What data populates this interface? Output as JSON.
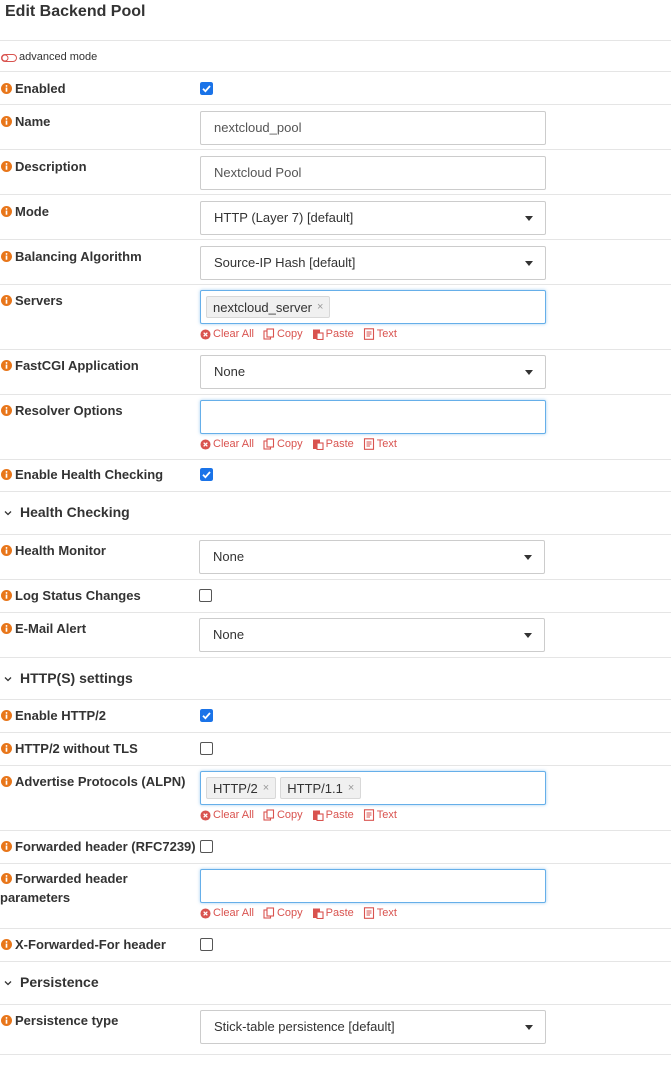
{
  "header": {
    "title": "Edit Backend Pool"
  },
  "advanced_mode": {
    "label": "advanced mode"
  },
  "tools": {
    "clear": "Clear All",
    "copy": "Copy",
    "paste": "Paste",
    "text": "Text"
  },
  "fields": {
    "enabled": {
      "label": "Enabled",
      "checked": true
    },
    "name": {
      "label": "Name",
      "value": "nextcloud_pool"
    },
    "description": {
      "label": "Description",
      "value": "Nextcloud Pool"
    },
    "mode": {
      "label": "Mode",
      "value": "HTTP (Layer 7) [default]"
    },
    "balancing": {
      "label": "Balancing Algorithm",
      "value": "Source-IP Hash [default]"
    },
    "servers": {
      "label": "Servers",
      "tags": [
        "nextcloud_server"
      ]
    },
    "fastcgi": {
      "label": "FastCGI Application",
      "value": "None"
    },
    "resolver": {
      "label": "Resolver Options",
      "value": ""
    },
    "enable_health": {
      "label": "Enable Health Checking",
      "checked": true
    },
    "health_monitor": {
      "label": "Health Monitor",
      "value": "None"
    },
    "log_status": {
      "label": "Log Status Changes",
      "checked": false
    },
    "email_alert": {
      "label": "E-Mail Alert",
      "value": "None"
    },
    "enable_http2": {
      "label": "Enable HTTP/2",
      "checked": true
    },
    "http2_no_tls": {
      "label": "HTTP/2 without TLS",
      "checked": false
    },
    "alpn": {
      "label": "Advertise Protocols (ALPN)",
      "tags": [
        "HTTP/2",
        "HTTP/1.1"
      ]
    },
    "fwd_header": {
      "label": "Forwarded header (RFC7239)",
      "checked": false
    },
    "fwd_params": {
      "label": "Forwarded header parameters",
      "value": ""
    },
    "xff": {
      "label": "X-Forwarded-For header",
      "checked": false
    },
    "persistence_type": {
      "label": "Persistence type",
      "value": "Stick-table persistence [default]"
    }
  },
  "sections": {
    "health": "Health Checking",
    "http": "HTTP(S) settings",
    "persistence": "Persistence"
  },
  "colors": {
    "info": "#e8761a",
    "check": "#1a73e8",
    "tool": "#d9534f",
    "focus": "#66afe9"
  }
}
